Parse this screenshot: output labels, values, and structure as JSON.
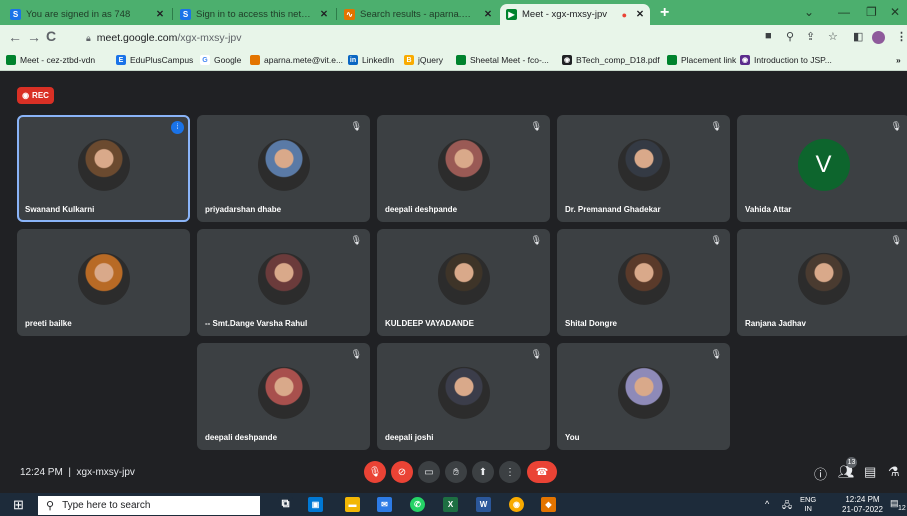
{
  "browser": {
    "tabs": [
      {
        "label": "You are signed in as 748",
        "favicon": "S"
      },
      {
        "label": "Sign in to access this network",
        "favicon": "S"
      },
      {
        "label": "Search results - aparna.mete@vit...",
        "favicon": "∿"
      },
      {
        "label": "Meet - xgx-mxsy-jpv",
        "favicon": "▶"
      }
    ],
    "url_host": "meet.google.com",
    "url_path": "/xgx-mxsy-jpv",
    "bookmarks": [
      "Meet - cez-ztbd-vdn",
      "EduPlusCampus",
      "Google",
      "aparna.mete@vit.e...",
      "LinkedIn",
      "jQuery",
      "Sheetal Meet - fco-...",
      "BTech_comp_D18.pdf",
      "Placement link",
      "Introduction to JSP..."
    ]
  },
  "meet": {
    "rec_label": "REC",
    "participants": [
      {
        "name": "Swanand Kulkarni",
        "kind": "photo",
        "color": "#6b4a2f"
      },
      {
        "name": "priyadarshan dhabe",
        "kind": "photo",
        "color": "#5a7aa6"
      },
      {
        "name": "deepali deshpande",
        "kind": "photo",
        "color": "#9a5a55"
      },
      {
        "name": "Dr. Premanand Ghadekar",
        "kind": "photo",
        "color": "#343a44"
      },
      {
        "name": "Vahida Attar",
        "kind": "initial",
        "initial": "V",
        "color": "#0d652d"
      },
      {
        "name": "preeti bailke",
        "kind": "photo",
        "color": "#b86a25"
      },
      {
        "name": "-- Smt.Dange Varsha Rahul",
        "kind": "photo",
        "color": "#6b3b3b"
      },
      {
        "name": "KULDEEP VAYADANDE",
        "kind": "photo",
        "color": "#3e3428"
      },
      {
        "name": "Shital Dongre",
        "kind": "photo",
        "color": "#5a3a2a"
      },
      {
        "name": "Ranjana Jadhav",
        "kind": "photo",
        "color": "#4a3b30"
      },
      {
        "name": "deepali deshpande",
        "kind": "photo",
        "color": "#a8504d"
      },
      {
        "name": "deepali joshi",
        "kind": "photo",
        "color": "#3b3d4a"
      },
      {
        "name": "You",
        "kind": "photo",
        "color": "#8e8ab8"
      }
    ],
    "time": "12:24 PM",
    "separator": "|",
    "meeting_code": "xgx-mxsy-jpv",
    "people_count": "13"
  },
  "taskbar": {
    "search_placeholder": "Type here to search",
    "lang_top": "ENG",
    "lang_bottom": "IN",
    "clock_time": "12:24 PM",
    "clock_date": "21-07-2022",
    "notif_count": "12"
  }
}
